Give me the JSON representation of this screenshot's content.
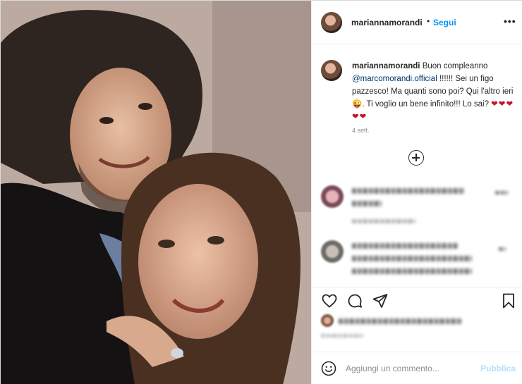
{
  "header": {
    "username": "mariannamorandi",
    "separator": "•",
    "follow_label": "Segui",
    "more_label": "•••"
  },
  "caption": {
    "username": "mariannamorandi",
    "text_before": "Buon compleanno",
    "mention": "@marcomorandi.official",
    "text_after": "!!!!!! Sei un figo pazzesco! Ma quanti sono poi? Qui l'altro ieri😜. Ti voglio un bene infinito!!! Lo sai?",
    "hearts": "❤❤❤❤❤",
    "age": "4 sett."
  },
  "add_comment": {
    "placeholder": "Aggiungi un commento...",
    "publish_label": "Pubblica"
  },
  "icons": {
    "like": "heart-icon",
    "comment": "comment-icon",
    "share": "send-icon",
    "save": "bookmark-icon",
    "emoji": "smiley-icon",
    "more": "more-options-icon",
    "load_more": "plus-circle-icon"
  },
  "colors": {
    "link_blue": "#0095f6",
    "mention_blue": "#00376b",
    "publish_disabled": "#b2dffc",
    "heart_red": "#c0162c",
    "meta_gray": "#8e8e8e"
  }
}
